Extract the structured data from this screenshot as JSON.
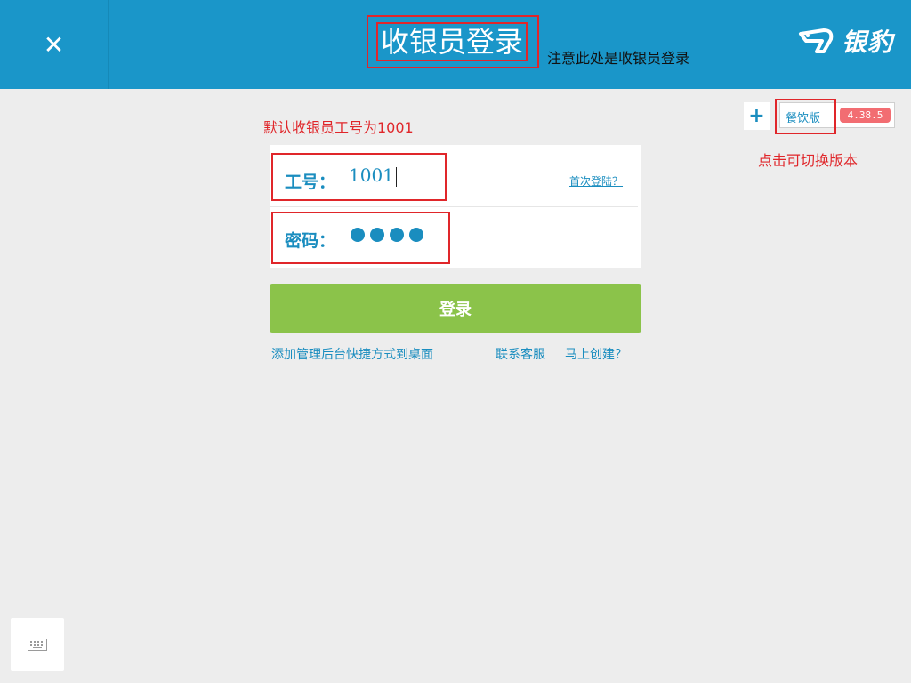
{
  "header": {
    "close_symbol": "✕",
    "title": "收银员登录",
    "note": "注意此处是收银员登录",
    "brand_name": "银豹",
    "bg_color": "#1a96c9"
  },
  "annotations": {
    "default_id_note": "默认收银员工号为1001",
    "switch_edition_note": "点击可切换版本",
    "highlight_color": "#e0262a"
  },
  "form": {
    "id_label": "工号：",
    "id_value": "1001",
    "first_login_link": "首次登陆？",
    "password_label": "密码：",
    "password_masked_count": 4
  },
  "login_button": {
    "label": "登录",
    "color": "#8bc34a"
  },
  "links": {
    "add_shortcut": "添加管理后台快捷方式到桌面",
    "contact_support": "联系客服",
    "create_now": "马上创建？"
  },
  "edition": {
    "plus_symbol": "+",
    "label": "餐饮版",
    "version": "4.38.5"
  },
  "icons": {
    "close": "close-icon",
    "brand_logo": "leopard-logo-icon",
    "plus": "plus-icon",
    "keyboard": "keyboard-icon"
  }
}
